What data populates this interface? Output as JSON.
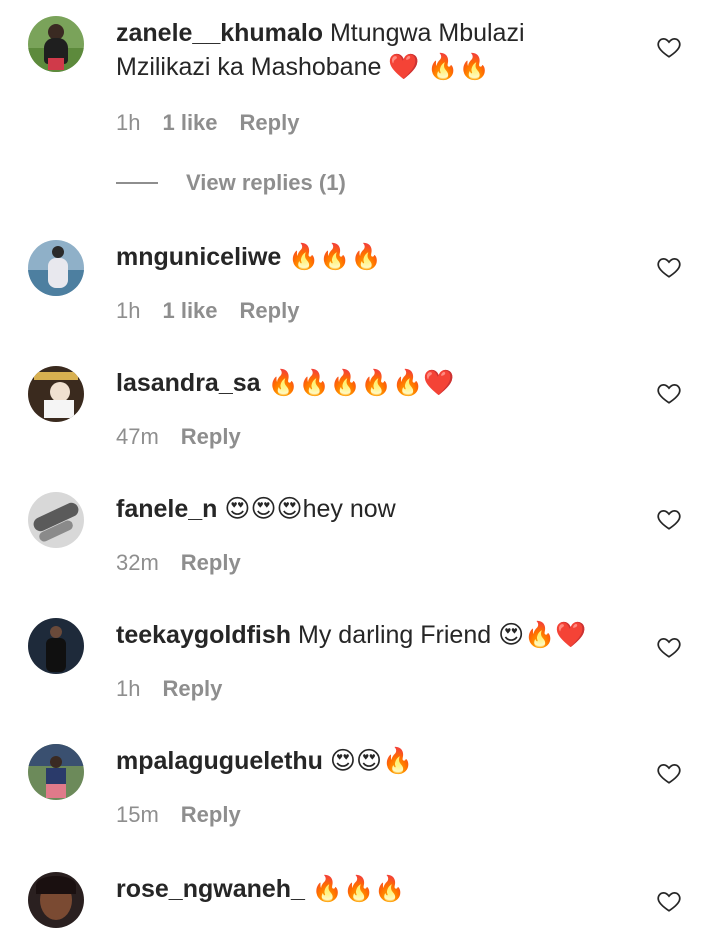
{
  "comments": [
    {
      "username": "zanele__khumalo",
      "text_line1": "Mtungwa Mbulazi",
      "text_line2": "Mzilikazi ka Mashobane",
      "emoji": "❤️ 🔥🔥",
      "time": "1h",
      "likes": "1 like",
      "reply": "Reply",
      "avatar_color": "#7aa35a"
    },
    {
      "username": "mnguniceliwe",
      "text": "",
      "emoji": "🔥🔥🔥",
      "time": "1h",
      "likes": "1 like",
      "reply": "Reply",
      "avatar_color": "#6f8fa8"
    },
    {
      "username": "lasandra_sa",
      "text": "",
      "emoji": "🔥🔥🔥🔥🔥❤️",
      "time": "47m",
      "likes": "",
      "reply": "Reply",
      "avatar_color": "#3a2a1e"
    },
    {
      "username": "fanele_n",
      "text": "hey now",
      "emoji": "😍😍😍",
      "time": "32m",
      "likes": "",
      "reply": "Reply",
      "avatar_color": "#9a9a9a"
    },
    {
      "username": "teekaygoldfish",
      "text": "My darling Friend",
      "emoji": "😍🔥❤️",
      "time": "1h",
      "likes": "",
      "reply": "Reply",
      "avatar_color": "#1e2a3a"
    },
    {
      "username": "mpalaguguelethu",
      "text": "",
      "emoji": "😍😍🔥",
      "time": "15m",
      "likes": "",
      "reply": "Reply",
      "avatar_color": "#6c8a5a"
    },
    {
      "username": "rose_ngwaneh_",
      "text": "",
      "emoji": "🔥🔥🔥",
      "time": "",
      "likes": "",
      "reply": "",
      "avatar_color": "#2a2020"
    }
  ],
  "view_replies": "View replies (1)",
  "colors": {
    "text": "#262626",
    "muted": "#8e8e8e",
    "background": "#ffffff"
  }
}
